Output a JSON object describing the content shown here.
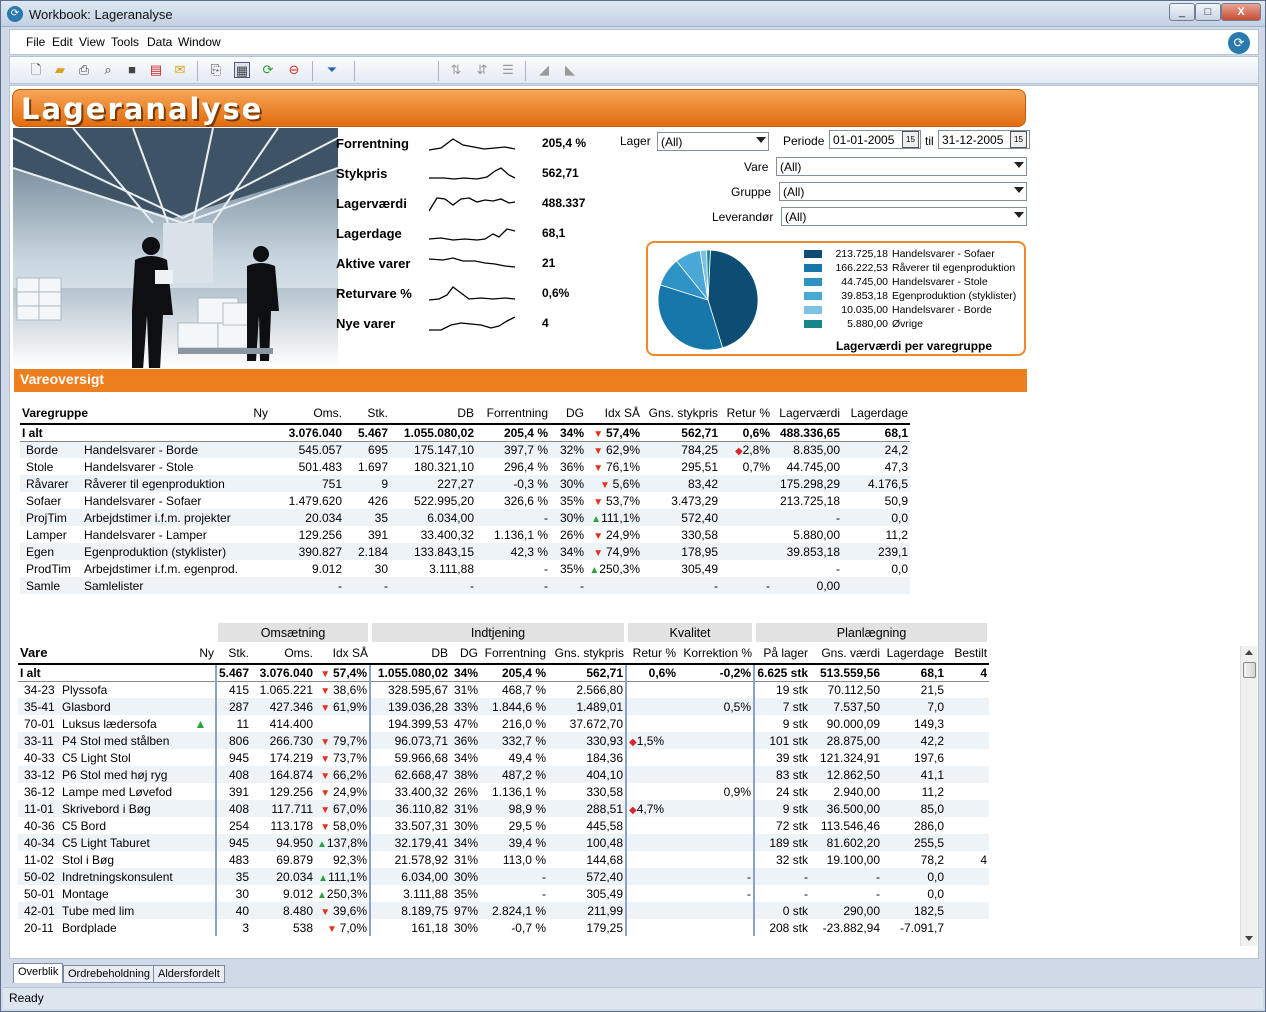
{
  "window": {
    "title": "Workbook: Lageranalyse",
    "min": "_",
    "max": "□",
    "close": "X"
  },
  "menu": [
    "File",
    "Edit",
    "View",
    "Tools",
    "Data",
    "Window"
  ],
  "banner": "Lageranalyse",
  "kpis": [
    {
      "label": "Forrentning",
      "value": "205,4 %"
    },
    {
      "label": "Stykpris",
      "value": "562,71"
    },
    {
      "label": "Lagerværdi",
      "value": "488.337"
    },
    {
      "label": "Lagerdage",
      "value": "68,1"
    },
    {
      "label": "Aktive varer",
      "value": "21"
    },
    {
      "label": "Returvare %",
      "value": "0,6%"
    },
    {
      "label": "Nye varer",
      "value": "4"
    }
  ],
  "filters": {
    "lager_label": "Lager",
    "lager": "(All)",
    "periode_label": "Periode",
    "from": "01-01-2005",
    "til": "til",
    "to": "31-12-2005",
    "vare_label": "Vare",
    "vare": "(All)",
    "gruppe_label": "Gruppe",
    "gruppe": "(All)",
    "lev_label": "Leverandør",
    "lev": "(All)"
  },
  "pie": {
    "title": "Lagerværdi per varegruppe",
    "slices": [
      {
        "value": 213725.18,
        "label": "213.725,18",
        "name": "Handelsvarer - Sofaer",
        "color": "#0e4d73"
      },
      {
        "value": 166222.53,
        "label": "166.222,53",
        "name": "Råverer til egenproduktion",
        "color": "#1777aa"
      },
      {
        "value": 44745.0,
        "label": "44.745,00",
        "name": "Handelsvarer - Stole",
        "color": "#2f92c4"
      },
      {
        "value": 39853.18,
        "label": "39.853,18",
        "name": "Egenproduktion (styklister)",
        "color": "#4aa8d6"
      },
      {
        "value": 10035.0,
        "label": "10.035,00",
        "name": "Handelsvarer - Borde",
        "color": "#7cc2e4"
      },
      {
        "value": 5880.0,
        "label": "5.880,00",
        "name": "Øvrige",
        "color": "#17868a"
      }
    ]
  },
  "section_title": "Vareoversigt",
  "t1": {
    "headers": [
      "Varegruppe",
      "",
      "Ny",
      "Oms.",
      "Stk.",
      "DB",
      "Forrentning",
      "DG",
      "Idx SÅ",
      "Gns. stykpris",
      "Retur %",
      "Lagerværdi",
      "Lagerdage"
    ],
    "total": [
      "I alt",
      "",
      "",
      "3.076.040",
      "5.467",
      "1.055.080,02",
      "205,4 %",
      "34%",
      "57,4%",
      "562,71",
      "0,6%",
      "488.336,65",
      "68,1"
    ],
    "rows": [
      [
        "Borde",
        "Handelsvarer - Borde",
        "",
        "545.057",
        "695",
        "175.147,10",
        "397,7 %",
        "32%",
        "62,9%",
        "784,25",
        "2,8%",
        "8.835,00",
        "24,2"
      ],
      [
        "Stole",
        "Handelsvarer - Stole",
        "",
        "501.483",
        "1.697",
        "180.321,10",
        "296,4 %",
        "36%",
        "76,1%",
        "295,51",
        "0,7%",
        "44.745,00",
        "47,3"
      ],
      [
        "Råvarer",
        "Råverer til egenproduktion",
        "",
        "751",
        "9",
        "227,27",
        "-0,3 %",
        "30%",
        "5,6%",
        "83,42",
        "",
        "175.298,29",
        "4.176,5"
      ],
      [
        "Sofaer",
        "Handelsvarer - Sofaer",
        "",
        "1.479.620",
        "426",
        "522.995,20",
        "326,6 %",
        "35%",
        "53,7%",
        "3.473,29",
        "",
        "213.725,18",
        "50,9"
      ],
      [
        "ProjTim",
        "Arbejdstimer i.f.m. projekter",
        "",
        "20.034",
        "35",
        "6.034,00",
        "-",
        "30%",
        "111,1%",
        "572,40",
        "",
        "-",
        "0,0"
      ],
      [
        "Lamper",
        "Handelsvarer - Lamper",
        "",
        "129.256",
        "391",
        "33.400,32",
        "1.136,1 %",
        "26%",
        "24,9%",
        "330,58",
        "",
        "5.880,00",
        "11,2"
      ],
      [
        "Egen",
        "Egenproduktion (styklister)",
        "",
        "390.827",
        "2.184",
        "133.843,15",
        "42,3 %",
        "34%",
        "74,9%",
        "178,95",
        "",
        "39.853,18",
        "239,1"
      ],
      [
        "ProdTim",
        "Arbejdstimer i.f.m. egenprod.",
        "",
        "9.012",
        "30",
        "3.111,88",
        "-",
        "35%",
        "250,3%",
        "305,49",
        "",
        "-",
        "0,0"
      ],
      [
        "Samle",
        "Samlelister",
        "",
        "-",
        "-",
        "-",
        "-",
        "-",
        "",
        "-",
        "-",
        "0,00",
        ""
      ]
    ],
    "idx_dir": [
      "dn",
      "dn",
      "dn",
      "dn",
      "up",
      "dn",
      "dn",
      "up",
      ""
    ],
    "ret_flag": [
      "dia",
      "",
      "",
      "",
      "",
      "",
      "",
      "",
      ""
    ]
  },
  "t2": {
    "groups": [
      "Omsætning",
      "Indtjening",
      "Kvalitet",
      "Planlægning"
    ],
    "headers": [
      "Vare",
      "",
      "Ny",
      "Stk.",
      "Oms.",
      "Idx SÅ",
      "DB",
      "DG",
      "Forrentning",
      "Gns. stykpris",
      "Retur %",
      "Korrektion %",
      "På lager",
      "Gns. værdi",
      "Lagerdage",
      "Bestilt"
    ],
    "total": [
      "I alt",
      "",
      "",
      "5.467",
      "3.076.040",
      "57,4%",
      "1.055.080,02",
      "34%",
      "205,4 %",
      "562,71",
      "0,6%",
      "-0,2%",
      "6.625 stk",
      "513.559,56",
      "68,1",
      "4"
    ],
    "rows": [
      [
        "34-23",
        "Plyssofa",
        "",
        "415",
        "1.065.221",
        "38,6%",
        "328.595,67",
        "31%",
        "468,7 %",
        "2.566,80",
        "",
        "",
        "19 stk",
        "70.112,50",
        "21,5",
        ""
      ],
      [
        "35-41",
        "Glasbord",
        "",
        "287",
        "427.346",
        "61,9%",
        "139.036,28",
        "33%",
        "1.844,6 %",
        "1.489,01",
        "",
        "0,5%",
        "7 stk",
        "7.537,50",
        "7,0",
        ""
      ],
      [
        "70-01",
        "Luksus lædersofa",
        "▲",
        "11",
        "414.400",
        "",
        "194.399,53",
        "47%",
        "216,0 %",
        "37.672,70",
        "",
        "",
        "9 stk",
        "90.000,09",
        "149,3",
        ""
      ],
      [
        "33-11",
        "P4 Stol med stålben",
        "",
        "806",
        "266.730",
        "79,7%",
        "96.073,71",
        "36%",
        "332,7 %",
        "330,93",
        "1,5%",
        "",
        "101 stk",
        "28.875,00",
        "42,2",
        ""
      ],
      [
        "40-33",
        "C5 Light Stol",
        "",
        "945",
        "174.219",
        "73,7%",
        "59.966,68",
        "34%",
        "49,4 %",
        "184,36",
        "",
        "",
        "39 stk",
        "121.324,91",
        "197,6",
        ""
      ],
      [
        "33-12",
        "P6 Stol med høj ryg",
        "",
        "408",
        "164.874",
        "66,2%",
        "62.668,47",
        "38%",
        "487,2 %",
        "404,10",
        "",
        "",
        "83 stk",
        "12.862,50",
        "41,1",
        ""
      ],
      [
        "36-12",
        "Lampe med Løvefod",
        "",
        "391",
        "129.256",
        "24,9%",
        "33.400,32",
        "26%",
        "1.136,1 %",
        "330,58",
        "",
        "0,9%",
        "24 stk",
        "2.940,00",
        "11,2",
        ""
      ],
      [
        "11-01",
        "Skrivebord i Bøg",
        "",
        "408",
        "117.711",
        "67,0%",
        "36.110,82",
        "31%",
        "98,9 %",
        "288,51",
        "4,7%",
        "",
        "9 stk",
        "36.500,00",
        "85,0",
        ""
      ],
      [
        "40-36",
        "C5 Bord",
        "",
        "254",
        "113.178",
        "58,0%",
        "33.507,31",
        "30%",
        "29,5 %",
        "445,58",
        "",
        "",
        "72 stk",
        "113.546,46",
        "286,0",
        ""
      ],
      [
        "40-34",
        "C5 Light Taburet",
        "",
        "945",
        "94.950",
        "137,8%",
        "32.179,41",
        "34%",
        "39,4 %",
        "100,48",
        "",
        "",
        "189 stk",
        "81.602,20",
        "255,5",
        ""
      ],
      [
        "11-02",
        "Stol i Bøg",
        "",
        "483",
        "69.879",
        "92,3%",
        "21.578,92",
        "31%",
        "113,0 %",
        "144,68",
        "",
        "",
        "32 stk",
        "19.100,00",
        "78,2",
        "4"
      ],
      [
        "50-02",
        "Indretningskonsulent",
        "",
        "35",
        "20.034",
        "111,1%",
        "6.034,00",
        "30%",
        "-",
        "572,40",
        "",
        "-",
        "-",
        "-",
        "0,0",
        ""
      ],
      [
        "50-01",
        "Montage",
        "",
        "30",
        "9.012",
        "250,3%",
        "3.111,88",
        "35%",
        "-",
        "305,49",
        "",
        "-",
        "-",
        "-",
        "0,0",
        ""
      ],
      [
        "42-01",
        "Tube med lim",
        "",
        "40",
        "8.480",
        "39,6%",
        "8.189,75",
        "97%",
        "2.824,1 %",
        "211,99",
        "",
        "",
        "0 stk",
        "290,00",
        "182,5",
        ""
      ],
      [
        "20-11",
        "Bordplade",
        "",
        "3",
        "538",
        "7,0%",
        "161,18",
        "30%",
        "-0,7 %",
        "179,25",
        "",
        "",
        "208 stk",
        "-23.882,94",
        "-7.091,7",
        ""
      ]
    ],
    "idx_dir": [
      "dn",
      "dn",
      "",
      "dn",
      "dn",
      "dn",
      "dn",
      "dn",
      "dn",
      "up",
      "",
      "up",
      "up",
      "dn",
      "dn"
    ],
    "ret_flag": [
      "",
      "",
      "",
      "dia",
      "",
      "",
      "",
      "dia",
      "",
      "",
      "",
      "",
      "",
      "",
      ""
    ]
  },
  "sheet_tabs": [
    "Overblik",
    "Ordrebeholdning",
    "Aldersfordelt"
  ],
  "status": "Ready"
}
